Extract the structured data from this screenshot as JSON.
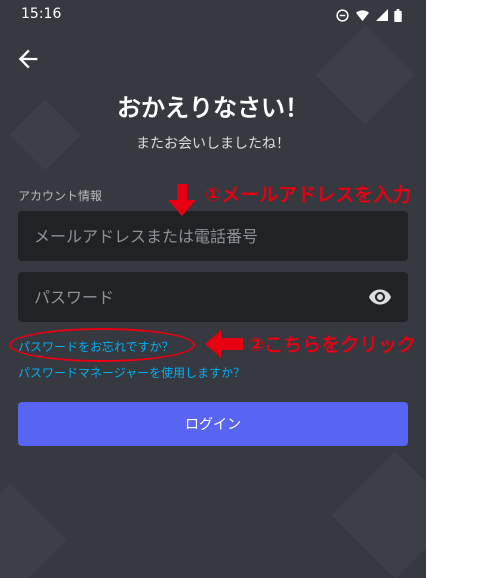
{
  "status_bar": {
    "time": "15:16",
    "icons": [
      "do-not-disturb-icon",
      "wifi-icon",
      "signal-icon",
      "battery-icon"
    ]
  },
  "header": {
    "back_icon": "arrow-left-icon"
  },
  "login": {
    "title": "おかえりなさい！",
    "subtitle": "またお会いしましたね！",
    "section_label": "アカウント情報",
    "email_placeholder": "メールアドレスまたは電話番号",
    "password_placeholder": "パスワード",
    "show_password_icon": "eye-icon",
    "forgot_password_link": "パスワードをお忘れですか？",
    "password_manager_link": "パスワードマネージャーを使用しますか？",
    "login_button": "ログイン"
  },
  "annotations": {
    "step1": "①メールアドレスを入力",
    "step2": "②こちらをクリック",
    "color": "#e60012"
  },
  "colors": {
    "background": "#36393f",
    "input_background": "#202225",
    "accent": "#5865f2",
    "link": "#00b0f4"
  }
}
